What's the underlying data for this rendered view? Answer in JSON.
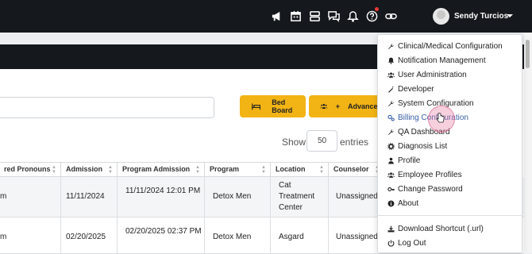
{
  "header": {
    "user_name": "Sendy Turcios",
    "icons": [
      "megaphone-icon",
      "calendar-icon",
      "list-icon",
      "chat-icon",
      "bell-icon",
      "help-icon",
      "link-icon"
    ]
  },
  "toolbar": {
    "bed_board_label": "Bed Board",
    "advanced_label": "Advanced",
    "advanced_prefix": "+",
    "show_label": "Show",
    "entries_value": "50",
    "entries_label": "entries"
  },
  "table": {
    "columns": [
      "red Pronouns",
      "Admission",
      "Program Admission",
      "Program",
      "Location",
      "Counselor"
    ],
    "rows": [
      {
        "c0": "m",
        "admission": "11/11/2024",
        "program_admission": "11/11/2024 12:01 PM",
        "program": "Detox Men",
        "location": "Cat Treatment Center",
        "counselor": "Unassigned"
      },
      {
        "c0": "m",
        "admission": "02/20/2025",
        "program_admission": "02/20/2025 02:37 PM",
        "program": "Detox Men",
        "location": "Asgard",
        "counselor": "Unassigned"
      }
    ]
  },
  "menu": {
    "items": [
      {
        "label": "Clinical/Medical Configuration",
        "icon": "wrench-icon"
      },
      {
        "label": "Notification Management",
        "icon": "bell-icon"
      },
      {
        "label": "User Administration",
        "icon": "users-icon"
      },
      {
        "label": "Developer",
        "icon": "magic-icon"
      },
      {
        "label": "System Configuration",
        "icon": "wrench-icon"
      },
      {
        "label": "Billing Configuration",
        "icon": "cogs-icon"
      },
      {
        "label": "QA Dashboard",
        "icon": "wrench-icon"
      },
      {
        "label": "Diagnosis List",
        "icon": "gear-icon"
      },
      {
        "label": "Profile",
        "icon": "user-icon"
      },
      {
        "label": "Employee Profiles",
        "icon": "users-icon"
      },
      {
        "label": "Change Password",
        "icon": "key-icon"
      },
      {
        "label": "About",
        "icon": "info-icon"
      }
    ],
    "footer": [
      {
        "label": "Download Shortcut (.url)",
        "icon": "download-icon"
      },
      {
        "label": "Log Out",
        "icon": "power-icon"
      }
    ]
  },
  "colors": {
    "accent": "#f2b315",
    "topbar": "#15181d",
    "link": "#3a5fa5"
  }
}
